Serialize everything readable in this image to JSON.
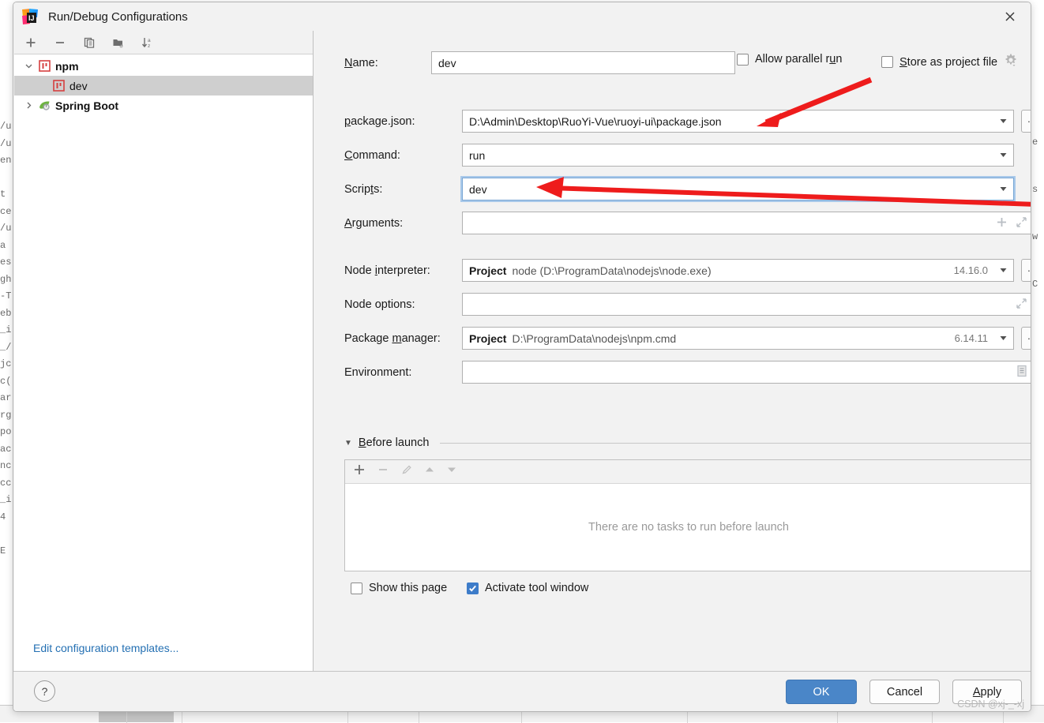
{
  "window": {
    "title": "Run/Debug Configurations",
    "logo_icon": "intellij-idea-logo-icon",
    "close_icon": "close-icon"
  },
  "left_panel": {
    "toolbar": [
      {
        "icon": "add-icon",
        "label": "Add New Configuration"
      },
      {
        "icon": "remove-icon",
        "label": "Remove Configuration"
      },
      {
        "icon": "copy-icon",
        "label": "Copy Configuration"
      },
      {
        "icon": "new-folder-icon",
        "label": "Create New Folder"
      },
      {
        "icon": "sort-alphabetically-icon",
        "label": "Sort Configurations"
      }
    ],
    "tree": [
      {
        "label": "npm",
        "icon": "npm-icon",
        "type": "group",
        "expanded": true,
        "twisty": "chevron-down-icon"
      },
      {
        "label": "dev",
        "icon": "npm-icon",
        "type": "child",
        "selected": true
      },
      {
        "label": "Spring Boot",
        "icon": "spring-boot-icon",
        "type": "group",
        "expanded": false,
        "twisty": "chevron-right-icon"
      }
    ],
    "edit_templates_link": "Edit configuration templates..."
  },
  "form": {
    "name": {
      "label": "Name:",
      "label_mnemonic": "N",
      "value": "dev"
    },
    "allow_parallel_run": {
      "label": "Allow parallel run",
      "label_mnemonic": "u",
      "checked": false
    },
    "store_as_project_file": {
      "label": "Store as project file",
      "label_mnemonic": "S",
      "checked": false,
      "gear_icon": "gear-dropdown-icon"
    },
    "package_json": {
      "label": "package.json:",
      "label_mnemonic": "p",
      "value": "D:\\Admin\\Desktop\\RuoYi-Vue\\ruoyi-ui\\package.json",
      "dropdown_icon": "chevron-down-icon",
      "browse_label": "..."
    },
    "command": {
      "label": "Command:",
      "label_mnemonic": "C",
      "value": "run",
      "dropdown_icon": "chevron-down-icon"
    },
    "scripts": {
      "label": "Scripts:",
      "label_mnemonic": "t",
      "value": "dev",
      "focused": true,
      "dropdown_icon": "chevron-down-icon"
    },
    "arguments": {
      "label": "Arguments:",
      "label_mnemonic": "A",
      "value": "",
      "add_icon": "plus-icon",
      "expand_icon": "expand-icon"
    },
    "node_interpreter": {
      "label": "Node interpreter:",
      "label_mnemonic": "i",
      "scope": "Project",
      "value": "node (D:\\ProgramData\\nodejs\\node.exe)",
      "version": "14.16.0",
      "dropdown_icon": "chevron-down-icon",
      "browse_label": "..."
    },
    "node_options": {
      "label": "Node options:",
      "value": "",
      "expand_icon": "expand-icon"
    },
    "package_manager": {
      "label": "Package manager:",
      "label_mnemonic": "m",
      "scope": "Project",
      "value": "D:\\ProgramData\\nodejs\\npm.cmd",
      "version": "6.14.11",
      "dropdown_icon": "chevron-down-icon",
      "browse_label": "..."
    },
    "environment": {
      "label": "Environment:",
      "value": "",
      "editor_icon": "environment-variables-icon"
    }
  },
  "before_launch": {
    "title": "Before launch",
    "title_mnemonic": "B",
    "collapse_icon": "triangle-down-icon",
    "toolbar": [
      {
        "icon": "plus-icon",
        "label": "Add task",
        "enabled": true
      },
      {
        "icon": "minus-icon",
        "label": "Remove task",
        "enabled": false
      },
      {
        "icon": "edit-pencil-icon",
        "label": "Edit task",
        "enabled": false
      },
      {
        "icon": "arrow-up-icon",
        "label": "Move up",
        "enabled": false
      },
      {
        "icon": "arrow-down-icon",
        "label": "Move down",
        "enabled": false
      }
    ],
    "empty_text": "There are no tasks to run before launch"
  },
  "options": {
    "show_this_page": {
      "label": "Show this page",
      "checked": false
    },
    "activate_tool_window": {
      "label": "Activate tool window",
      "checked": true
    }
  },
  "footer": {
    "help_label": "?",
    "ok_label": "OK",
    "cancel_label": "Cancel",
    "apply_label": "Apply",
    "apply_mnemonic": "A"
  },
  "watermark": "CSDN @xj-_-xj",
  "annotations": [
    {
      "name": "package-json-arrow",
      "color": "#ee1c1c"
    },
    {
      "name": "scripts-arrow",
      "color": "#ee1c1c"
    }
  ],
  "background": {
    "left_gutter_text": "/u\n/u\nen\n\nt\nce\n/u\na .\nes\ngh\n-T\neb\n_i\n_/\njс\nc(\nar\nrg\npo\nac\nnc\ncc\n_i\n4\n\nE"
  }
}
